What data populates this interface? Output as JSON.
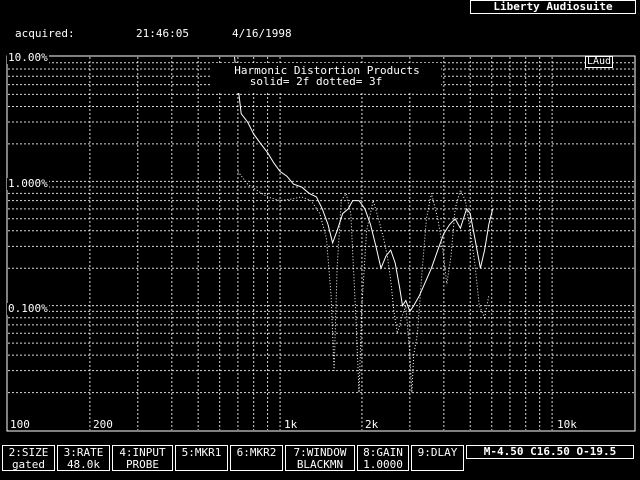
{
  "app": {
    "brand": "Liberty Audiosuite"
  },
  "header": {
    "acquired_label": "acquired:",
    "time": "21:46:05",
    "date": "4/16/1998"
  },
  "chart_data": {
    "type": "line",
    "title": "Harmonic Distortion Products",
    "subtitle": "solid= 2f  dotted= 3f",
    "badge": "LAud",
    "xscale": "log",
    "yscale": "log",
    "xlim": [
      100,
      20000
    ],
    "ylim": [
      0.01,
      10
    ],
    "x_tick_labels": [
      "100",
      "200",
      "1k",
      "2k",
      "10k"
    ],
    "x_tick_values": [
      100,
      200,
      1000,
      2000,
      10000
    ],
    "y_tick_labels": [
      "10.00%",
      "1.000%",
      "0.100%"
    ],
    "y_tick_values": [
      10,
      1,
      0.1
    ],
    "grid": true,
    "series": [
      {
        "name": "2f",
        "style": "solid",
        "points": [
          [
            680,
            10
          ],
          [
            720,
            3.5
          ],
          [
            760,
            3.0
          ],
          [
            800,
            2.4
          ],
          [
            850,
            2.0
          ],
          [
            900,
            1.7
          ],
          [
            950,
            1.4
          ],
          [
            1000,
            1.2
          ],
          [
            1060,
            1.1
          ],
          [
            1120,
            0.95
          ],
          [
            1200,
            0.9
          ],
          [
            1280,
            0.8
          ],
          [
            1360,
            0.75
          ],
          [
            1430,
            0.6
          ],
          [
            1500,
            0.45
          ],
          [
            1560,
            0.32
          ],
          [
            1620,
            0.4
          ],
          [
            1700,
            0.55
          ],
          [
            1780,
            0.6
          ],
          [
            1850,
            0.7
          ],
          [
            1950,
            0.7
          ],
          [
            2050,
            0.6
          ],
          [
            2150,
            0.45
          ],
          [
            2250,
            0.3
          ],
          [
            2350,
            0.2
          ],
          [
            2450,
            0.25
          ],
          [
            2550,
            0.28
          ],
          [
            2650,
            0.22
          ],
          [
            2750,
            0.14
          ],
          [
            2820,
            0.1
          ],
          [
            2900,
            0.11
          ],
          [
            3000,
            0.09
          ],
          [
            3100,
            0.1
          ],
          [
            3250,
            0.12
          ],
          [
            3400,
            0.15
          ],
          [
            3600,
            0.2
          ],
          [
            3800,
            0.28
          ],
          [
            4000,
            0.38
          ],
          [
            4200,
            0.45
          ],
          [
            4400,
            0.5
          ],
          [
            4600,
            0.42
          ],
          [
            4850,
            0.6
          ],
          [
            5000,
            0.55
          ],
          [
            5200,
            0.35
          ],
          [
            5450,
            0.2
          ],
          [
            5650,
            0.28
          ],
          [
            5850,
            0.45
          ],
          [
            6050,
            0.6
          ]
        ]
      },
      {
        "name": "3f",
        "style": "dotted",
        "points": [
          [
            700,
            1.2
          ],
          [
            760,
            0.95
          ],
          [
            820,
            0.85
          ],
          [
            900,
            0.75
          ],
          [
            1000,
            0.7
          ],
          [
            1100,
            0.72
          ],
          [
            1200,
            0.75
          ],
          [
            1300,
            0.7
          ],
          [
            1400,
            0.55
          ],
          [
            1480,
            0.35
          ],
          [
            1540,
            0.12
          ],
          [
            1580,
            0.03
          ],
          [
            1620,
            0.2
          ],
          [
            1680,
            0.7
          ],
          [
            1750,
            0.8
          ],
          [
            1820,
            0.55
          ],
          [
            1900,
            0.08
          ],
          [
            1950,
            0.02
          ],
          [
            2000,
            0.1
          ],
          [
            2080,
            0.4
          ],
          [
            2200,
            0.7
          ],
          [
            2300,
            0.5
          ],
          [
            2400,
            0.35
          ],
          [
            2480,
            0.25
          ],
          [
            2560,
            0.15
          ],
          [
            2620,
            0.09
          ],
          [
            2700,
            0.06
          ],
          [
            2800,
            0.08
          ],
          [
            2900,
            0.1
          ],
          [
            3000,
            0.04
          ],
          [
            3050,
            0.02
          ],
          [
            3100,
            0.04
          ],
          [
            3200,
            0.06
          ],
          [
            3300,
            0.15
          ],
          [
            3450,
            0.5
          ],
          [
            3600,
            0.8
          ],
          [
            3800,
            0.5
          ],
          [
            3950,
            0.3
          ],
          [
            4100,
            0.15
          ],
          [
            4250,
            0.25
          ],
          [
            4400,
            0.6
          ],
          [
            4600,
            0.85
          ],
          [
            4800,
            0.7
          ],
          [
            5000,
            0.4
          ],
          [
            5200,
            0.22
          ],
          [
            5400,
            0.1
          ],
          [
            5650,
            0.08
          ],
          [
            5850,
            0.12
          ]
        ]
      }
    ]
  },
  "function_keys": [
    {
      "line1": "2:SIZE",
      "line2": "gated"
    },
    {
      "line1": "3:RATE",
      "line2": "48.0k"
    },
    {
      "line1": "4:INPUT",
      "line2": "PROBE"
    },
    {
      "line1": "5:MKR1",
      "line2": ""
    },
    {
      "line1": "6:MKR2",
      "line2": ""
    },
    {
      "line1": "7:WINDOW",
      "line2": "BLACKMN"
    },
    {
      "line1": "8:GAIN",
      "line2": "1.0000"
    },
    {
      "line1": "9:DLAY",
      "line2": ""
    }
  ],
  "status": {
    "text": "M-4.50 C16.50 O-19.5"
  }
}
